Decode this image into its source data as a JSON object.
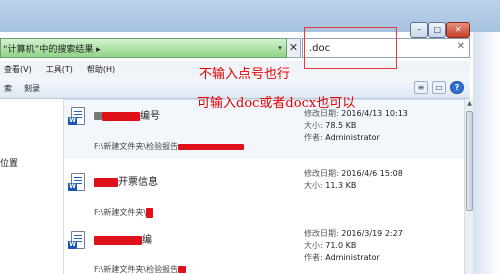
{
  "window": {
    "minimize_symbol": "–",
    "maximize_symbol": "□",
    "close_symbol": "✕"
  },
  "address": {
    "breadcrumb": "“计算机”中的搜索结果  ▸",
    "dropdown_symbol": "▾",
    "clear_symbol": "✕"
  },
  "search": {
    "value": ".doc",
    "clear_symbol": "✕"
  },
  "menu": {
    "items": [
      {
        "label": "查看(V)"
      },
      {
        "label": "工具(T)"
      },
      {
        "label": "帮助(H)"
      }
    ]
  },
  "toolbar": {
    "items": [
      {
        "label": "索"
      },
      {
        "label": "刻录"
      }
    ],
    "help_symbol": "?"
  },
  "nav": {
    "location_label": "位置"
  },
  "results": [
    {
      "name_visible": "编号",
      "path_prefix": "F:\\新建文件夹\\检验报告",
      "modified_label": "修改日期:",
      "modified_value": "2016/4/13 10:13",
      "size_label": "大小:",
      "size_value": "78.5 KB",
      "author_label": "作者:",
      "author_value": "Administrator"
    },
    {
      "name_visible": "开票信息",
      "path_prefix": "F:\\新建文件夹\\",
      "modified_label": "修改日期:",
      "modified_value": "2016/4/6 15:08",
      "size_label": "大小:",
      "size_value": "11.3 KB",
      "author_label": "作者:",
      "author_value": ""
    },
    {
      "name_visible": "编",
      "path_prefix": "F:\\新建文件夹\\检验报告",
      "modified_label": "修改日期:",
      "modified_value": "2016/3/19 2:27",
      "size_label": "大小:",
      "size_value": "71.0 KB",
      "author_label": "作者:",
      "author_value": "Administrator"
    }
  ],
  "annotations": {
    "line1": "不输入点号也行",
    "line2": "可输入doc或者docx也可以",
    "color": "#e60000"
  }
}
